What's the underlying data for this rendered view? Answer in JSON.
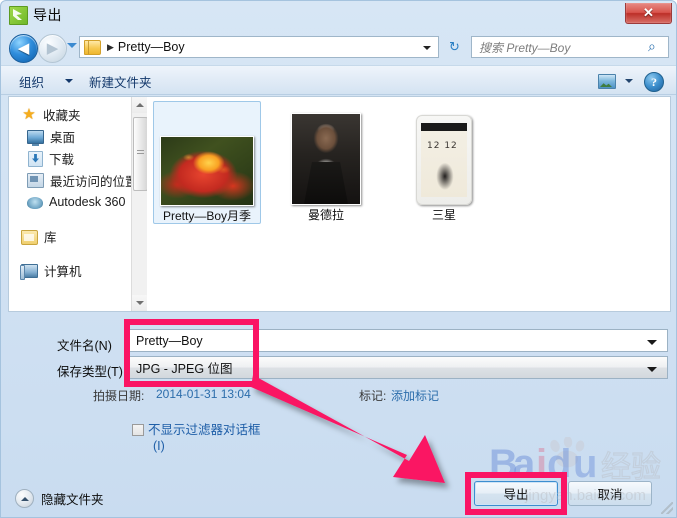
{
  "window": {
    "title": "导出",
    "app_icon": "export-app-icon",
    "close_label": "✕"
  },
  "navigation": {
    "back_icon": "back-arrow-icon",
    "back_glyph": "◀",
    "forward_icon": "forward-arrow-icon",
    "forward_glyph": "▶",
    "recent_dropdown_icon": "chevron-down-icon",
    "address_path": "Pretty—Boy",
    "address_separator": "▶",
    "folder_icon": "folder-icon",
    "refresh_icon": "refresh-icon",
    "refresh_glyph": "↻"
  },
  "search": {
    "placeholder": "搜索 Pretty—Boy",
    "icon": "search-icon",
    "glyph": "⌕"
  },
  "toolbar": {
    "organize_label": "组织",
    "new_folder_label": "新建文件夹",
    "view_icon": "view-mode-icon",
    "view_caret_icon": "chevron-down-icon",
    "help_icon": "help-icon",
    "help_glyph": "?"
  },
  "sidebar": {
    "items": [
      {
        "label": "收藏夹",
        "icon": "star-icon",
        "root": true
      },
      {
        "label": "桌面",
        "icon": "desktop-icon",
        "root": false
      },
      {
        "label": "下载",
        "icon": "download-icon",
        "root": false
      },
      {
        "label": "最近访问的位置",
        "icon": "recent-places-icon",
        "root": false
      },
      {
        "label": "Autodesk 360",
        "icon": "cloud-icon",
        "root": false
      },
      {
        "label": "库",
        "icon": "library-icon",
        "root": true
      },
      {
        "label": "计算机",
        "icon": "computer-icon",
        "root": true
      }
    ]
  },
  "files": [
    {
      "label": "Pretty—Boy月季",
      "thumb": "rose-thumbnail",
      "selected": true
    },
    {
      "label": "曼德拉",
      "thumb": "portrait-thumbnail",
      "selected": false
    },
    {
      "label": "三星",
      "thumb": "phone-screenshot-thumbnail",
      "selected": false
    }
  ],
  "phone_thumb": {
    "clock": "12 12"
  },
  "form": {
    "filename_label": "文件名(N)",
    "filename_value": "Pretty—Boy",
    "filetype_label": "保存类型(T)",
    "filetype_value": "JPG - JPEG 位图",
    "date_label": "拍摄日期:",
    "date_value": "2014-01-31 13:04",
    "tag_label": "标记:",
    "tag_value": "添加标记",
    "filter_checkbox_label": "不显示过滤器对话框",
    "filter_checkbox_label_line2": "(I)",
    "filter_checked": false
  },
  "footer": {
    "hide_folders_label": "隐藏文件夹",
    "hide_folders_icon": "chevron-up-circle-icon",
    "export_label": "导出",
    "cancel_label": "取消",
    "resize_grip_icon": "resize-grip-icon"
  },
  "annotations": {
    "highlight_color": "#fa1464",
    "arrow_icon": "pointer-arrow-annotation",
    "fields_box": "filename-and-filetype-highlight",
    "export_box": "export-button-highlight"
  },
  "watermark": {
    "brand": "Baidu",
    "suffix": "经验",
    "url": "jingyan.baidu.com",
    "logo_icon": "baidu-paw-logo-icon"
  }
}
